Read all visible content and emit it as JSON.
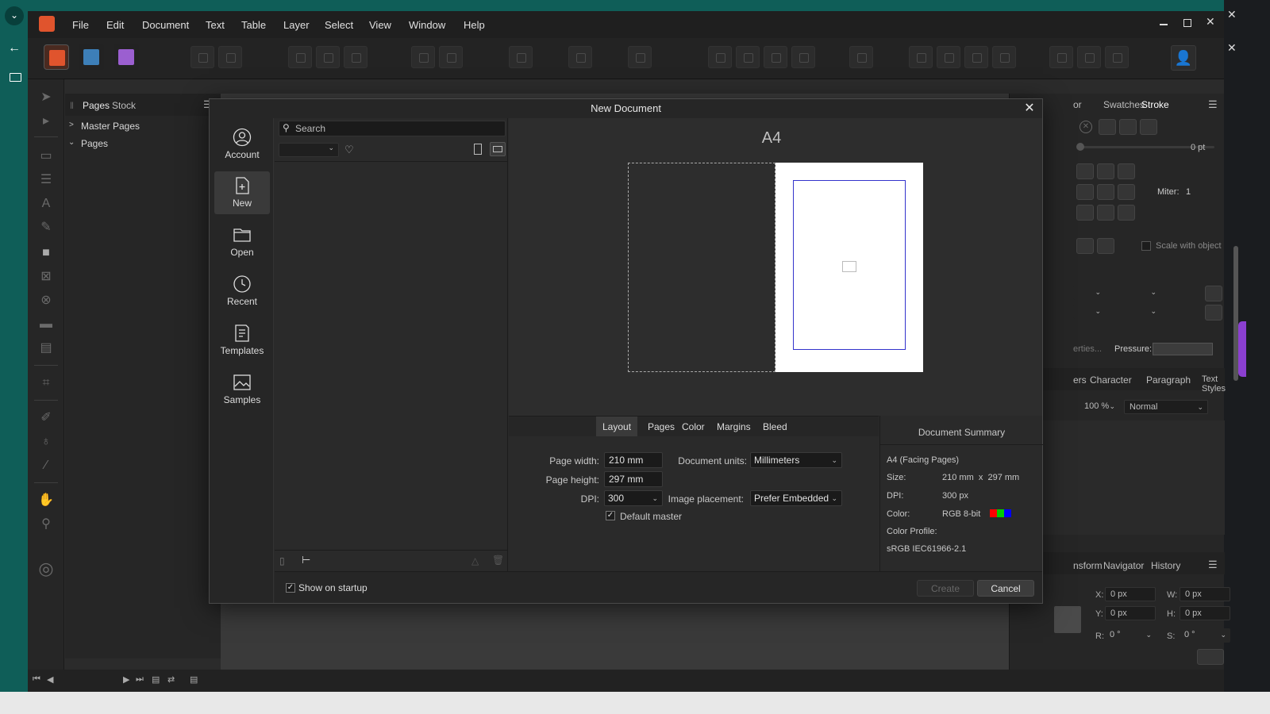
{
  "menu": [
    "File",
    "Edit",
    "Document",
    "Text",
    "Table",
    "Layer",
    "Select",
    "View",
    "Window",
    "Help"
  ],
  "pages_panel": {
    "tabs": [
      "Pages",
      "Stock"
    ],
    "rows": [
      "Master Pages",
      "Pages"
    ]
  },
  "right_panel": {
    "top_tabs": [
      "or",
      "Swatches",
      "Stroke"
    ],
    "stroke_width": "0 pt",
    "miter_label": "Miter:",
    "miter_value": "1",
    "scale_label": "Scale with object",
    "properties_label": "erties...",
    "pressure_label": "Pressure:",
    "text_tabs": [
      "ers",
      "Character",
      "Paragraph",
      "Text Styles"
    ],
    "opacity": "100 %",
    "blend_mode": "Normal",
    "transform_tabs": [
      "nsform",
      "Navigator",
      "History"
    ],
    "transform": {
      "x_label": "X:",
      "x": "0 px",
      "w_label": "W:",
      "w": "0 px",
      "y_label": "Y:",
      "y": "0 px",
      "h_label": "H:",
      "h": "0 px",
      "r_label": "R:",
      "r": "0 °",
      "s_label": "S:",
      "s": "0 °"
    }
  },
  "dialog": {
    "title": "New Document",
    "nav": [
      "Account",
      "New",
      "Open",
      "Recent",
      "Templates",
      "Samples"
    ],
    "search_placeholder": "Search",
    "preview_title": "A4",
    "tabs": [
      "Layout",
      "Pages",
      "Color",
      "Margins",
      "Bleed"
    ],
    "layout": {
      "page_width_label": "Page width:",
      "page_width": "210 mm",
      "page_height_label": "Page height:",
      "page_height": "297 mm",
      "dpi_label": "DPI:",
      "dpi": "300",
      "default_master_label": "Default master",
      "units_label": "Document units:",
      "units": "Millimeters",
      "image_placement_label": "Image placement:",
      "image_placement": "Prefer Embedded"
    },
    "summary": {
      "title": "Document Summary",
      "name": "A4 (Facing Pages)",
      "size_label": "Size:",
      "size": "210 mm  x  297 mm",
      "dpi_label": "DPI:",
      "dpi": "300 px",
      "color_label": "Color:",
      "color": "RGB 8-bit",
      "profile_label": "Color Profile:",
      "profile": "sRGB IEC61966-2.1"
    },
    "show_on_startup": "Show on startup",
    "create_label": "Create",
    "cancel_label": "Cancel"
  },
  "colors": {
    "accent_teal": "#0f5e58",
    "page_border": "#3333cc",
    "rgb_red": "#ff0000",
    "rgb_green": "#00cc00",
    "rgb_blue": "#0000ff"
  }
}
